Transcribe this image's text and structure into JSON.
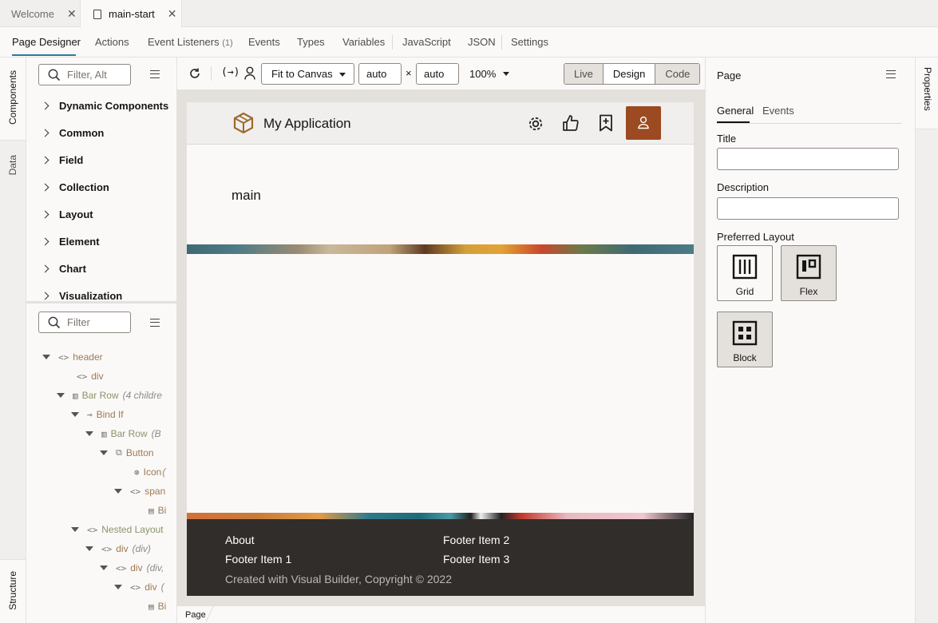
{
  "tabs": [
    {
      "label": "Welcome",
      "active": false
    },
    {
      "label": "main-start",
      "active": true
    }
  ],
  "subnav": {
    "items": [
      "Page Designer",
      "Actions",
      "Event Listeners",
      "Events",
      "Types",
      "Variables",
      "JavaScript",
      "JSON",
      "Settings"
    ],
    "event_listeners_count": "(1)"
  },
  "left_rail": {
    "components": "Components",
    "data": "Data",
    "structure": "Structure"
  },
  "components_panel": {
    "search_placeholder": "Filter, Alt",
    "categories": [
      "Dynamic Components",
      "Common",
      "Field",
      "Collection",
      "Layout",
      "Element",
      "Chart",
      "Visualization"
    ]
  },
  "structure_panel": {
    "search_placeholder": "Filter",
    "nodes": [
      {
        "label": "header",
        "meta": ""
      },
      {
        "label": "div",
        "meta": ""
      },
      {
        "label": "Bar Row",
        "meta": "(4 childre"
      },
      {
        "label": "Bind If",
        "meta": ""
      },
      {
        "label": "Bar Row",
        "meta": "(B"
      },
      {
        "label": "Button",
        "meta": ""
      },
      {
        "label": "Icon",
        "meta": "("
      },
      {
        "label": "span",
        "meta": ""
      },
      {
        "label": "Bi",
        "meta": ""
      },
      {
        "label": "Nested Layout",
        "meta": ""
      },
      {
        "label": "div",
        "meta": "(div)"
      },
      {
        "label": "div",
        "meta": "(div,"
      },
      {
        "label": "div",
        "meta": "("
      },
      {
        "label": "Bi",
        "meta": ""
      }
    ]
  },
  "toolbar": {
    "fit_label": "Fit to Canvas",
    "width": "auto",
    "times": "×",
    "height": "auto",
    "zoom": "100%",
    "modes": [
      "Live",
      "Design",
      "Code"
    ],
    "active_mode": "Design"
  },
  "app": {
    "title": "My Application",
    "main_text": "main",
    "footer": {
      "col1": [
        "About",
        "Footer Item 1"
      ],
      "col2": [
        "Footer Item 2",
        "Footer Item 3"
      ],
      "copyright": "Created with Visual Builder, Copyright © 2022"
    }
  },
  "breadcrumb": {
    "page": "Page"
  },
  "properties": {
    "header": "Page",
    "tabs": [
      "General",
      "Events"
    ],
    "title_label": "Title",
    "title_value": "",
    "description_label": "Description",
    "description_value": "",
    "preferred_layout_label": "Preferred Layout",
    "layouts": [
      "Grid",
      "Flex",
      "Block"
    ],
    "rail_label": "Properties"
  },
  "colors": {
    "accent": "#227e9e",
    "footer_bg": "#312d2a",
    "logo": "#9d6a2c",
    "avatar": "#9b4a22"
  }
}
